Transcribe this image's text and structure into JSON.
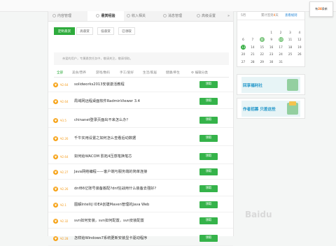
{
  "topbar": {
    "badge_prefix": "有",
    "badge_count": "24",
    "badge_suffix": "条新"
  },
  "tabs": [
    {
      "label": "内容管理",
      "active": false
    },
    {
      "label": "悬赏经验",
      "active": true
    },
    {
      "label": "收入相关",
      "active": false
    },
    {
      "label": "消息管理",
      "active": false
    },
    {
      "label": "高级设置",
      "active": false
    },
    {
      "label": "»",
      "active": false
    }
  ],
  "subtabs": [
    {
      "label": "定制悬赏",
      "active": true
    },
    {
      "label": "高悬赏",
      "active": false
    },
    {
      "label": "低悬赏",
      "active": false
    },
    {
      "label": "已领取",
      "active": false
    }
  ],
  "notice": "亲爱的用户，专属悬赏任务中，敬请关注，敬请领取。",
  "categories": [
    {
      "label": "全部",
      "active": true
    },
    {
      "label": "美食/营养",
      "active": false
    },
    {
      "label": "游戏/数码",
      "active": false
    },
    {
      "label": "手工/爱好",
      "active": false
    },
    {
      "label": "生活/家居",
      "active": false
    },
    {
      "label": "健康/养生",
      "active": false
    },
    {
      "label": "⚙ 编辑分类",
      "active": false
    }
  ],
  "coin_symbol": "¥",
  "claim_label": "领取",
  "tasks": [
    {
      "reward": "¥2.64",
      "title": "solidworks2013安装激活教程"
    },
    {
      "reward": "¥2.64",
      "title": "局域网远程桌面软件RadminViewer 3.4"
    },
    {
      "reward": "¥3.5",
      "title": "chinanet登录页面出不来怎么办？"
    },
    {
      "reward": "¥2.26",
      "title": "千牛实用设置之如何怎么查看后动数据"
    },
    {
      "reward": "¥2.64",
      "title": "如何给WACOM 影拓4压感笔换笔芯"
    },
    {
      "reward": "¥2.27",
      "title": "Java网络编程——客户端与服务端的简单连接"
    },
    {
      "reward": "¥2.26",
      "title": "dnf86亿账号装备搬配?dnf狂战用什么装备去强好?"
    },
    {
      "reward": "¥2.1",
      "title": "图解IntelliJ IDEA创建Maven管理的Java Web"
    },
    {
      "reward": "¥2.32",
      "title": "svn如何安装，svn如何配置，svn安装配置"
    },
    {
      "reward": "¥2.28",
      "title": "怎样给Windows7系统更新安装显卡驱动程序"
    }
  ],
  "calendar": {
    "month": "5月",
    "cumulative_prefix": "累计签到",
    "cumulative_days": "4",
    "cumulative_suffix": "天",
    "rules_label": "查看规则",
    "rows": [
      [
        {
          "d": "",
          "s": ""
        },
        {
          "d": "",
          "s": ""
        },
        {
          "d": "",
          "s": ""
        },
        {
          "d": "",
          "s": ""
        },
        {
          "d": "",
          "s": ""
        },
        {
          "d": "",
          "s": ""
        },
        {
          "d": "",
          "s": ""
        }
      ],
      [
        {
          "d": "",
          "s": ""
        },
        {
          "d": "",
          "s": ""
        },
        {
          "d": "",
          "s": ""
        },
        {
          "d": "1",
          "s": ""
        },
        {
          "d": "2",
          "s": ""
        },
        {
          "d": "3",
          "s": ""
        },
        {
          "d": "4",
          "s": ""
        }
      ],
      [
        {
          "d": "6",
          "s": ""
        },
        {
          "d": "7",
          "s": ""
        },
        {
          "d": "8",
          "s": "signed"
        },
        {
          "d": "9",
          "s": ""
        },
        {
          "d": "10",
          "s": "signed"
        },
        {
          "d": "11",
          "s": ""
        },
        {
          "d": "12",
          "s": ""
        }
      ],
      [
        {
          "d": "13",
          "s": "today"
        },
        {
          "d": "14",
          "s": ""
        },
        {
          "d": "15",
          "s": ""
        },
        {
          "d": "16",
          "s": ""
        },
        {
          "d": "17",
          "s": ""
        },
        {
          "d": "18",
          "s": ""
        },
        {
          "d": "19",
          "s": ""
        }
      ],
      [
        {
          "d": "20",
          "s": ""
        },
        {
          "d": "21",
          "s": ""
        },
        {
          "d": "22",
          "s": ""
        },
        {
          "d": "23",
          "s": ""
        },
        {
          "d": "24",
          "s": ""
        },
        {
          "d": "25",
          "s": ""
        },
        {
          "d": "26",
          "s": ""
        }
      ],
      [
        {
          "d": "27",
          "s": ""
        },
        {
          "d": "28",
          "s": ""
        },
        {
          "d": "29",
          "s": ""
        },
        {
          "d": "30",
          "s": ""
        },
        {
          "d": "31",
          "s": ""
        },
        {
          "d": "",
          "s": ""
        },
        {
          "d": "",
          "s": ""
        }
      ]
    ]
  },
  "ads": [
    {
      "text": "回享福利社"
    },
    {
      "text": "作者招募 只差这些"
    }
  ],
  "watermark": "Baidu"
}
